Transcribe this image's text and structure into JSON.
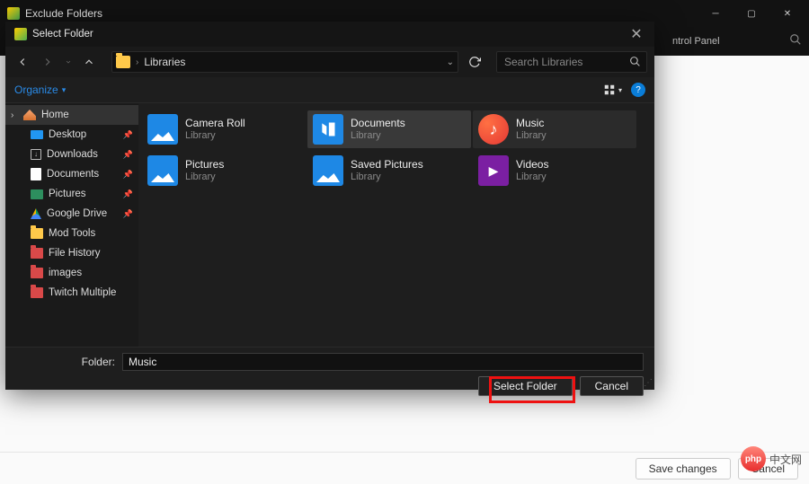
{
  "parentWindow": {
    "title": "Exclude Folders",
    "panelLabel": "ntrol Panel",
    "saveBtn": "Save changes",
    "cancelBtn": "Cancel"
  },
  "phpBadge": {
    "abbr": "php",
    "text": "中文网"
  },
  "dialog": {
    "title": "Select Folder",
    "organize": "Organize",
    "address": "Libraries",
    "searchPlaceholder": "Search Libraries",
    "folderLabel": "Folder:",
    "folderValue": "Music",
    "selectBtn": "Select Folder",
    "cancelBtn": "Cancel"
  },
  "sidebar": {
    "home": "Home",
    "items": [
      {
        "label": "Desktop",
        "pin": true
      },
      {
        "label": "Downloads",
        "pin": true
      },
      {
        "label": "Documents",
        "pin": true
      },
      {
        "label": "Pictures",
        "pin": true
      },
      {
        "label": "Google Drive",
        "pin": true
      },
      {
        "label": "Mod Tools"
      },
      {
        "label": "File History"
      },
      {
        "label": "images"
      },
      {
        "label": "Twitch Multiple"
      }
    ]
  },
  "libraries": {
    "sub": "Library",
    "items": [
      {
        "name": "Camera Roll",
        "type": "img"
      },
      {
        "name": "Documents",
        "type": "doc",
        "selected": true
      },
      {
        "name": "Music",
        "type": "music",
        "hover": true
      },
      {
        "name": "Pictures",
        "type": "img"
      },
      {
        "name": "Saved Pictures",
        "type": "img"
      },
      {
        "name": "Videos",
        "type": "video"
      }
    ]
  }
}
